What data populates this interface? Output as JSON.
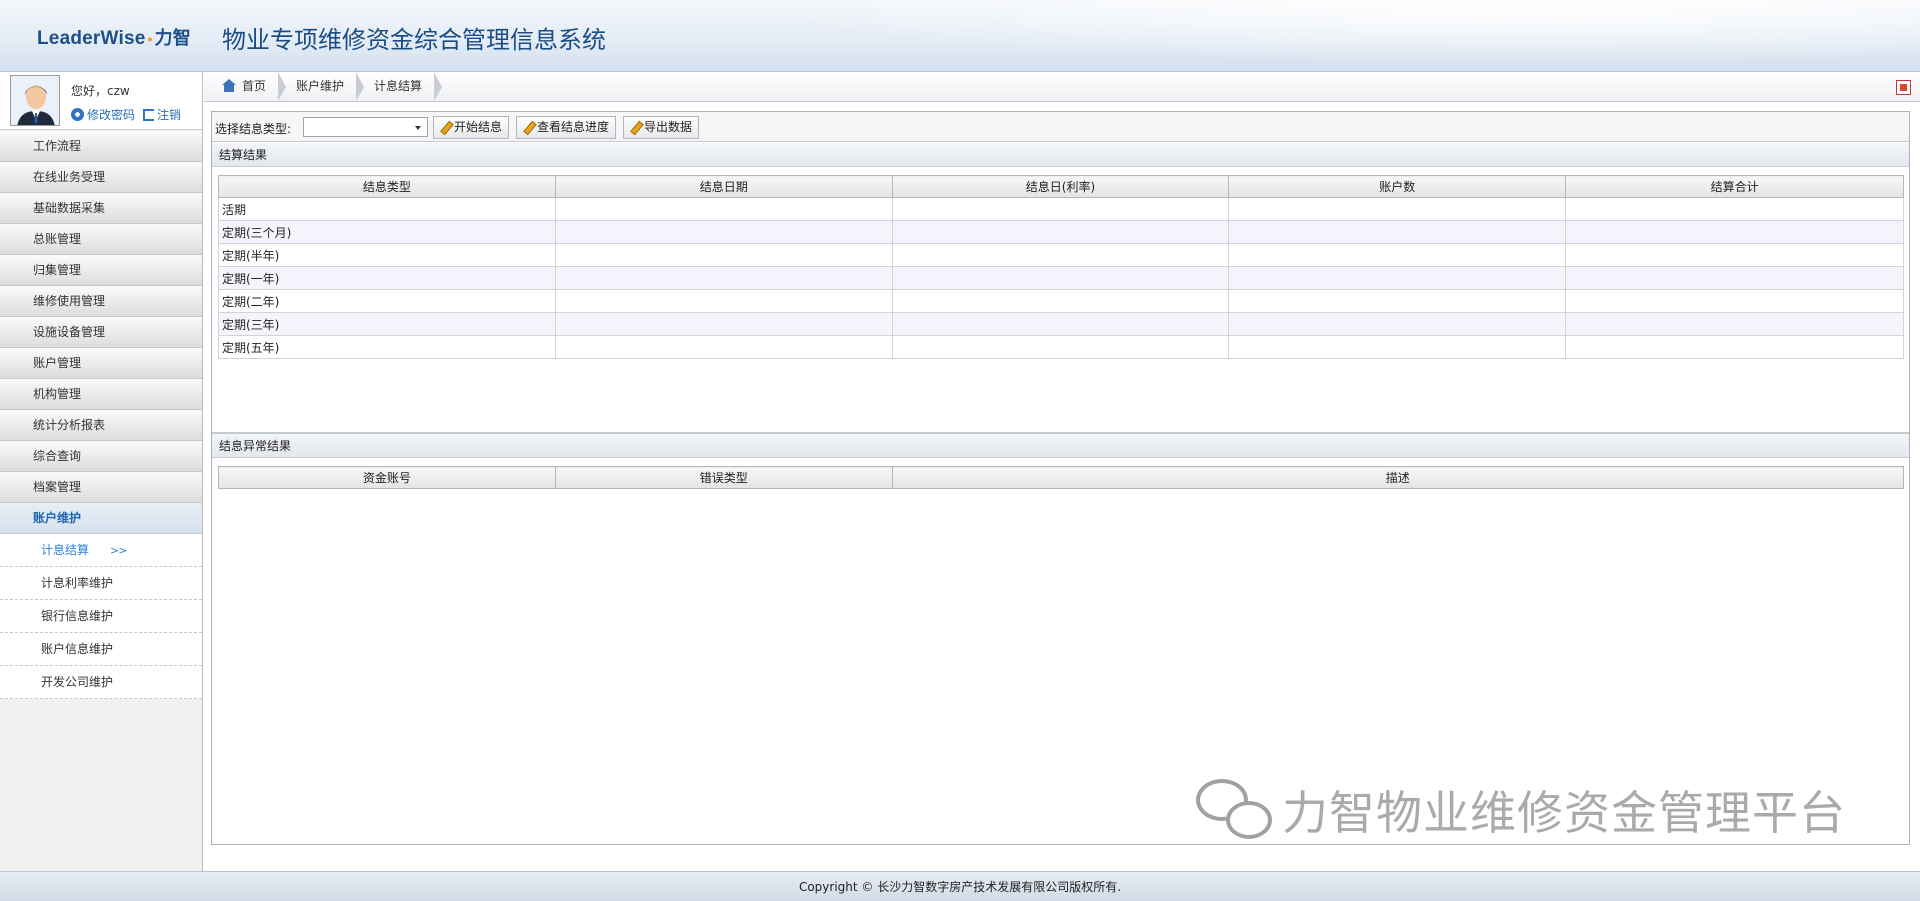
{
  "header": {
    "logo_en": "LeaderWise",
    "logo_dot": "•",
    "logo_cn": "力智",
    "system_title": "物业专项维修资金综合管理信息系统"
  },
  "user": {
    "greeting": "您好，czw",
    "change_password": "修改密码",
    "logout": "注销"
  },
  "sidebar": {
    "items": [
      {
        "label": "工作流程"
      },
      {
        "label": "在线业务受理"
      },
      {
        "label": "基础数据采集"
      },
      {
        "label": "总账管理"
      },
      {
        "label": "归集管理"
      },
      {
        "label": "维修使用管理"
      },
      {
        "label": "设施设备管理"
      },
      {
        "label": "账户管理"
      },
      {
        "label": "机构管理"
      },
      {
        "label": "统计分析报表"
      },
      {
        "label": "综合查询"
      },
      {
        "label": "档案管理"
      },
      {
        "label": "账户维护"
      }
    ],
    "subitems": [
      {
        "label": "计息结算",
        "arrow": ">>"
      },
      {
        "label": "计息利率维护"
      },
      {
        "label": "银行信息维护"
      },
      {
        "label": "账户信息维护"
      },
      {
        "label": "开发公司维护"
      }
    ]
  },
  "breadcrumb": {
    "home": "首页",
    "level1": "账户维护",
    "level2": "计息结算"
  },
  "toolbar": {
    "select_label": "选择结息类型:",
    "select_value": "",
    "btn_start": "开始结息",
    "btn_progress": "查看结息进度",
    "btn_export": "导出数据"
  },
  "result_section": {
    "title": "结算结果",
    "columns": [
      "结息类型",
      "结息日期",
      "结息日(利率)",
      "账户数",
      "结算合计"
    ],
    "rows": [
      [
        "活期",
        "",
        "",
        "",
        ""
      ],
      [
        "定期(三个月)",
        "",
        "",
        "",
        ""
      ],
      [
        "定期(半年)",
        "",
        "",
        "",
        ""
      ],
      [
        "定期(一年)",
        "",
        "",
        "",
        ""
      ],
      [
        "定期(二年)",
        "",
        "",
        "",
        ""
      ],
      [
        "定期(三年)",
        "",
        "",
        "",
        ""
      ],
      [
        "定期(五年)",
        "",
        "",
        "",
        ""
      ]
    ]
  },
  "error_section": {
    "title": "结息异常结果",
    "columns": [
      "资金账号",
      "错误类型",
      "描述"
    ]
  },
  "watermark": {
    "text": "力智物业维修资金管理平台",
    "icon": "wechat-icon"
  },
  "footer": {
    "copyright": "Copyright © 长沙力智数字房产技术发展有限公司版权所有."
  },
  "colors": {
    "title_blue": "#1a4d86",
    "link_blue": "#2a6fb7",
    "active_blue": "#2f84d4",
    "alt_row": "#f5f3fb"
  }
}
